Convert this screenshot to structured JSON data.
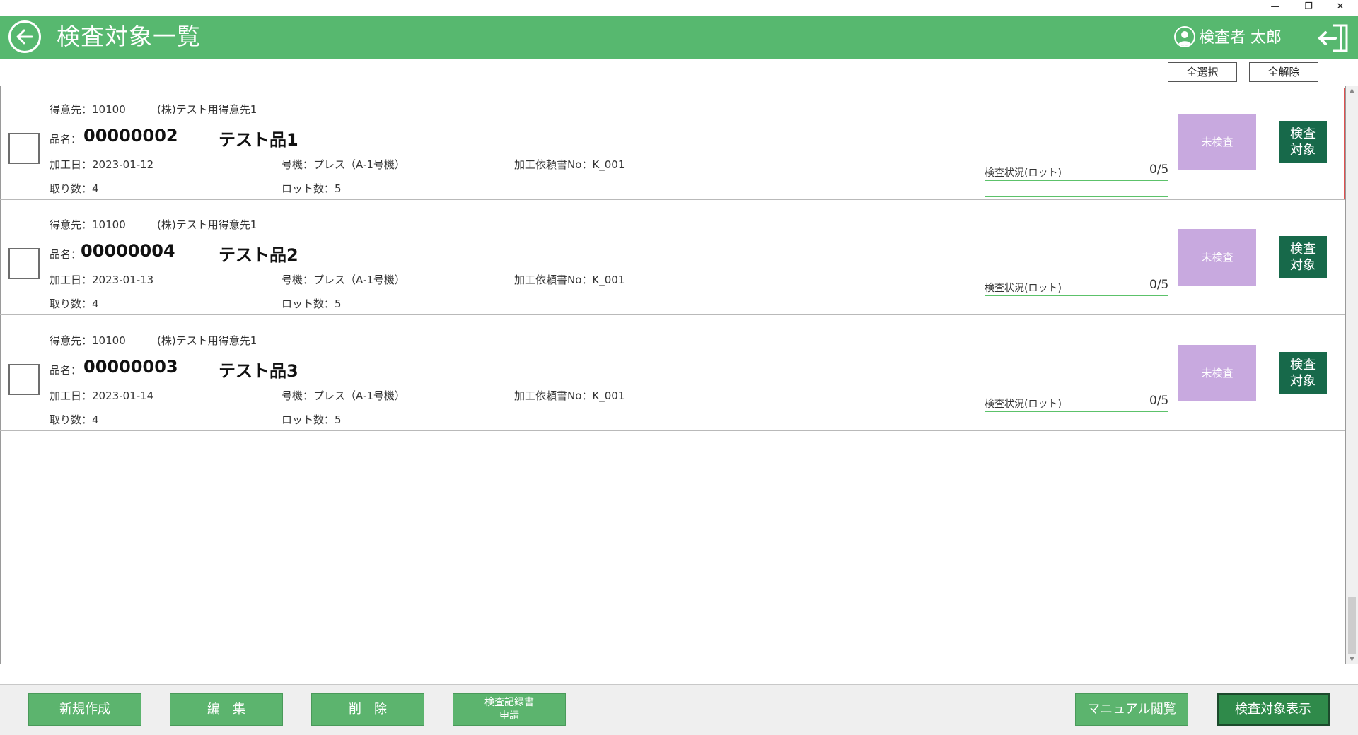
{
  "window": {
    "minimize_icon": "minimize-icon",
    "restore_icon": "restore-icon",
    "close_icon": "close-icon"
  },
  "header": {
    "title": "検査対象一覧",
    "user_name": "検査者 太郎",
    "back_icon": "arrow-left-circle-icon",
    "user_icon": "user-icon",
    "logout_icon": "logout-icon",
    "color": "#57b86f"
  },
  "toolbar": {
    "select_all": "全選択",
    "deselect_all": "全解除"
  },
  "labels": {
    "customer": "得意先：",
    "product": "品名：",
    "processing_date": "加工日：",
    "machine": "号機：",
    "request_no": "加工依頼書No：",
    "takes": "取り数：",
    "lots": "ロット数：",
    "status_label": "検査状況(ロット)"
  },
  "items": [
    {
      "customer_code": "10100",
      "customer_name": "(株)テスト用得意先1",
      "product_code": "00000002",
      "product_name": "テスト品1",
      "date": "2023-01-12",
      "machine": "プレス（A-1号機）",
      "request_no": "K_001",
      "takes": "4",
      "lots": "5",
      "progress_text": "0/5",
      "progress": 0,
      "status": "未検査",
      "target_button": "検査\n対象"
    },
    {
      "customer_code": "10100",
      "customer_name": "(株)テスト用得意先1",
      "product_code": "00000004",
      "product_name": "テスト品2",
      "date": "2023-01-13",
      "machine": "プレス（A-1号機）",
      "request_no": "K_001",
      "takes": "4",
      "lots": "5",
      "progress_text": "0/5",
      "progress": 0,
      "status": "未検査",
      "target_button": "検査\n対象"
    },
    {
      "customer_code": "10100",
      "customer_name": "(株)テスト用得意先1",
      "product_code": "00000003",
      "product_name": "テスト品3",
      "date": "2023-01-14",
      "machine": "プレス（A-1号機）",
      "request_no": "K_001",
      "takes": "4",
      "lots": "5",
      "progress_text": "0/5",
      "progress": 0,
      "status": "未検査",
      "target_button": "検査\n対象"
    }
  ],
  "footer": {
    "new": "新規作成",
    "edit": "編　集",
    "delete": "削　除",
    "record_line1": "検査記録書",
    "record_line2": "申請",
    "manual": "マニュアル閲覧",
    "show_targets": "検査対象表示"
  },
  "colors": {
    "status_pending": "#c8a9df",
    "target_button": "#17694a",
    "footer_button": "#5cb46e",
    "progress": "#5cc26a"
  }
}
